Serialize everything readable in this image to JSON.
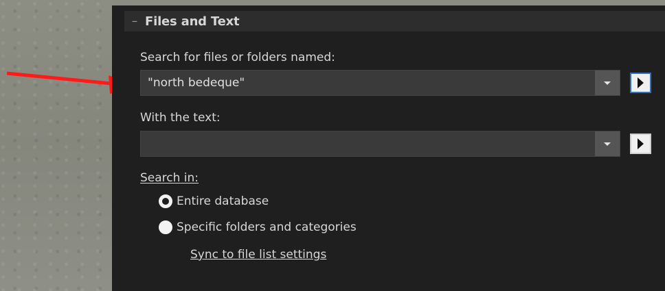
{
  "section": {
    "collapse_glyph": "–",
    "title": "Files and Text"
  },
  "search_files": {
    "label": "Search for files or folders named:",
    "value": "\"north bedeque\""
  },
  "with_text": {
    "label": "With the text:",
    "value": ""
  },
  "search_in": {
    "label": "Search in:",
    "options": [
      {
        "label": "Entire database",
        "selected": true
      },
      {
        "label": "Specific folders and categories",
        "selected": false
      }
    ],
    "sync_link": "Sync to file list settings"
  },
  "colors": {
    "panel_bg": "#1f1f1f",
    "accent_button_border": "#2f72c4",
    "annotation_arrow": "#ff1a1a"
  }
}
